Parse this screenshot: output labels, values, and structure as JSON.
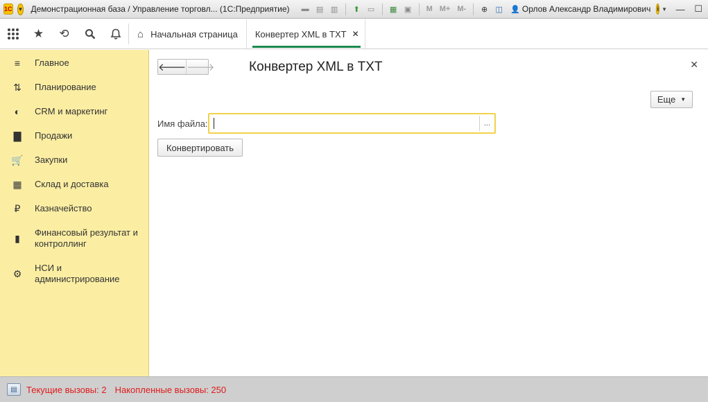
{
  "window": {
    "title": "Демонстрационная база / Управление торговл...  (1С:Предприятие)",
    "user": "Орлов Александр Владимирович",
    "toolbar_labels": [
      "M",
      "M+",
      "M-"
    ]
  },
  "tabs": [
    {
      "label": "Начальная страница",
      "icon": "home-icon"
    },
    {
      "label": "Конвертер XML в TXT",
      "active": true
    }
  ],
  "sidebar": {
    "items": [
      {
        "label": "Главное",
        "icon": "hamburger-icon"
      },
      {
        "label": "Планирование",
        "icon": "planning-icon"
      },
      {
        "label": "CRM и маркетинг",
        "icon": "crm-icon"
      },
      {
        "label": "Продажи",
        "icon": "bag-icon"
      },
      {
        "label": "Закупки",
        "icon": "cart-icon"
      },
      {
        "label": "Склад и доставка",
        "icon": "warehouse-icon"
      },
      {
        "label": "Казначейство",
        "icon": "ruble-icon"
      },
      {
        "label": "Финансовый результат и контроллинг",
        "icon": "bar-chart-icon"
      },
      {
        "label": "НСИ и администрирование",
        "icon": "gear-icon"
      }
    ]
  },
  "form": {
    "title": "Конвертер XML в TXT",
    "more_label": "Еще",
    "file_label": "Имя файла:",
    "file_value": "",
    "select_label": "...",
    "convert_label": "Конвертировать"
  },
  "status": {
    "current_calls": "Текущие вызовы: 2",
    "accumulated_calls": "Накопленные вызовы: 250"
  },
  "colors": {
    "sidebar_bg": "#fbeea3",
    "accent": "#1a8a4e",
    "field_focus": "#f0d24a",
    "status_text": "#e01b1b"
  }
}
